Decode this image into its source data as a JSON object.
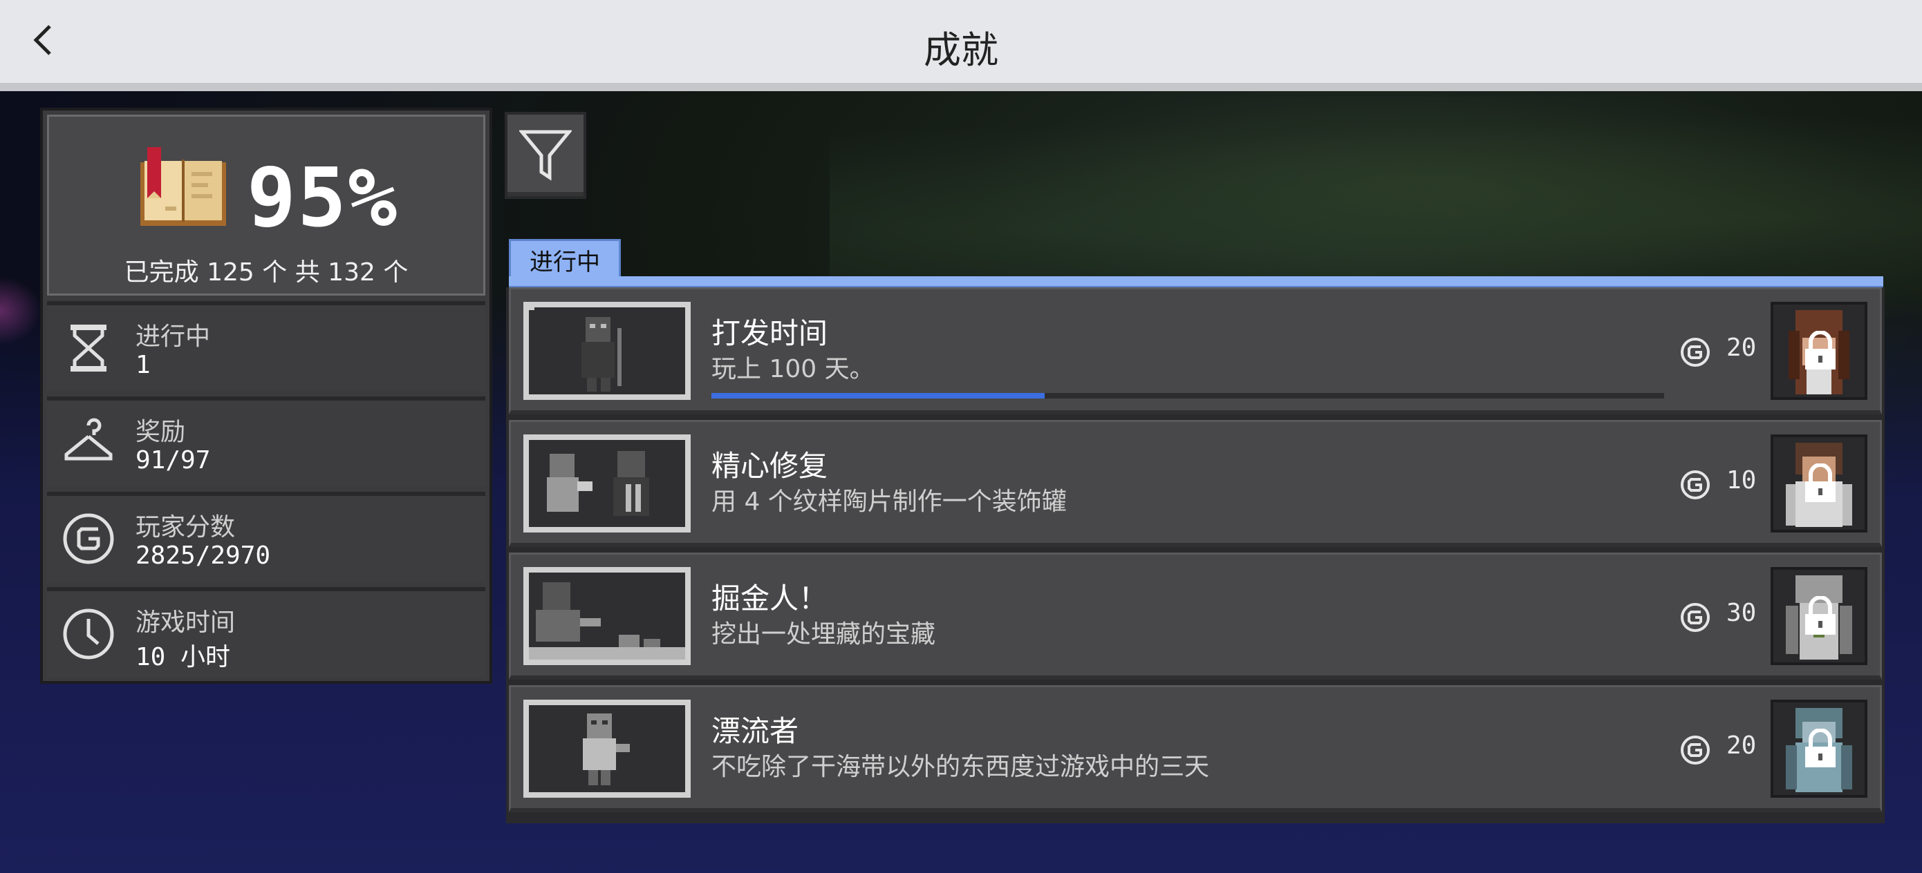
{
  "header": {
    "title": "成就"
  },
  "summary": {
    "percent": "95%",
    "completed_text": "已完成 125 个 共 132 个"
  },
  "stats": [
    {
      "icon": "hourglass-icon",
      "label": "进行中",
      "value": "1"
    },
    {
      "icon": "hanger-icon",
      "label": "奖励",
      "value": "91/97"
    },
    {
      "icon": "gamerscore-icon",
      "label": "玩家分数",
      "value": "2825/2970"
    },
    {
      "icon": "clock-icon",
      "label": "游戏时间",
      "value": "10 小时"
    }
  ],
  "tabs": [
    {
      "label": "进行中",
      "selected": true
    }
  ],
  "achievements": [
    {
      "name": "打发时间",
      "description": "玩上 100 天。",
      "score": "20",
      "progress": 0.35,
      "reward_color": "#6b3a26"
    },
    {
      "name": "精心修复",
      "description": "用 4 个纹样陶片制作一个装饰罐",
      "score": "10",
      "progress": null,
      "reward_color": "#5a3a2a"
    },
    {
      "name": "掘金人！",
      "description": "挖出一处埋藏的宝藏",
      "score": "30",
      "progress": null,
      "reward_color": "#8a8a8a"
    },
    {
      "name": "漂流者",
      "description": "不吃除了干海带以外的东西度过游戏中的三天",
      "score": "20",
      "progress": null,
      "reward_color": "#5c7c86"
    }
  ],
  "colors": {
    "accent": "#3c6ee0",
    "tab": "#8eb2f4",
    "panel": "#48484a"
  }
}
